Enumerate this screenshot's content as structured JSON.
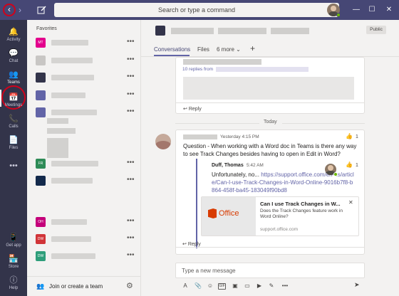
{
  "titlebar": {
    "back_glyph": "‹",
    "forward_glyph": "›",
    "search_placeholder": "Search or type a command",
    "minimize": "—",
    "maximize": "☐",
    "close": "✕"
  },
  "rail": {
    "items": [
      {
        "label": "Activity",
        "icon": "bell-icon",
        "glyph": "🔔"
      },
      {
        "label": "Chat",
        "icon": "chat-icon",
        "glyph": "💬"
      },
      {
        "label": "Teams",
        "icon": "teams-icon",
        "glyph": "👥"
      },
      {
        "label": "Meetings",
        "icon": "calendar-icon",
        "glyph": "📅"
      },
      {
        "label": "Calls",
        "icon": "phone-icon",
        "glyph": "📞"
      },
      {
        "label": "Files",
        "icon": "file-icon",
        "glyph": "📄"
      },
      {
        "label": "",
        "icon": "more-icon",
        "glyph": "•••"
      }
    ],
    "bottom": [
      {
        "label": "Get app",
        "icon": "device-icon",
        "glyph": "📱"
      },
      {
        "label": "Store",
        "icon": "store-icon",
        "glyph": "🏪"
      },
      {
        "label": "Help",
        "icon": "help-icon",
        "glyph": "ⓘ"
      }
    ]
  },
  "teams_panel": {
    "favorites_label": "Favorites",
    "teams": [
      {
        "initials": "MT",
        "color": "#e3008c"
      },
      {
        "initials": "",
        "color": "#c8c6c4"
      },
      {
        "initials": "",
        "color": "#33344a"
      },
      {
        "initials": "",
        "color": "#6264a7"
      },
      {
        "initials": "",
        "color": "#6264a7"
      },
      {
        "initials": "",
        "color": "#c8c6c4"
      },
      {
        "initials": "",
        "color": "#c8c6c4"
      },
      {
        "initials": "",
        "color": "#c8c6c4"
      },
      {
        "initials": "FR",
        "color": "#2e8b57"
      },
      {
        "initials": "",
        "color": "#13294b"
      },
      {
        "initials": "",
        "color": "#c8c6c4"
      },
      {
        "initials": "OH",
        "color": "#c4007a"
      },
      {
        "initials": "DW",
        "color": "#d13438"
      },
      {
        "initials": "DW",
        "color": "#2e9e7a"
      }
    ],
    "more_glyph": "•••",
    "join_label": "Join or create a team"
  },
  "channel": {
    "public_label": "Public",
    "tabs": [
      {
        "label": "Conversations"
      },
      {
        "label": "Files"
      },
      {
        "label": "6 more ⌄"
      }
    ],
    "add_tab_glyph": "+"
  },
  "conversation": {
    "first_thread": {
      "replies_from": "10 replies from",
      "reply_label": "Reply"
    },
    "day_label": "Today",
    "post": {
      "time": "Yesterday 4:15 PM",
      "body": "Question - When working with a Word doc in Teams is there any way to see Track Changes besides having to open in Edit in Word?",
      "likes": "1",
      "reply": {
        "author": "Duff, Thomas",
        "time": "5:42 AM",
        "text_prefix": "Unfortunately, no...",
        "link": "https://support.office.com/en-us/article/Can-I-use-Track-Changes-in-Word-Online-9016b7f8-b864-458f-ba45-183049f90bd8",
        "likes": "1",
        "preview": {
          "brand": "Office",
          "title": "Can I use Track Changes in W...",
          "description": "Does the Track Changes feature work in Word Online?",
          "domain": "support.office.com"
        }
      },
      "reply_label": "Reply"
    }
  },
  "compose": {
    "placeholder": "Type a new message",
    "tools": [
      "A",
      "📎",
      "☺",
      "GIF",
      "▣",
      "▭",
      "▶",
      "✎",
      "•••"
    ],
    "send_glyph": "➤"
  }
}
